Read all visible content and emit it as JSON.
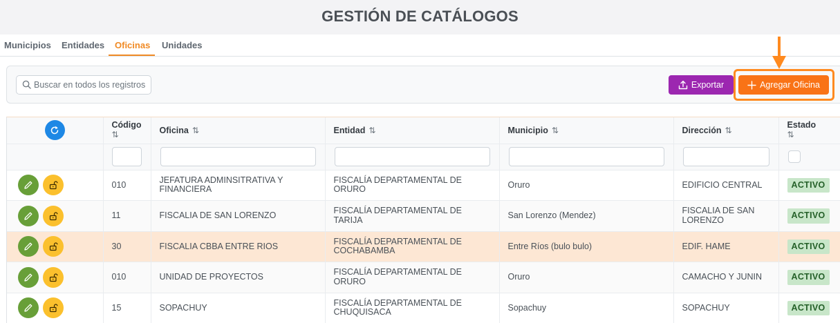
{
  "header": {
    "title": "GESTIÓN DE CATÁLOGOS"
  },
  "tabs": [
    {
      "label": "Municipios",
      "active": false
    },
    {
      "label": "Entidades",
      "active": false
    },
    {
      "label": "Oficinas",
      "active": true
    },
    {
      "label": "Unidades",
      "active": false
    }
  ],
  "toolbar": {
    "search_placeholder": "Buscar en todos los registros",
    "export_label": "Exportar",
    "add_label": "Agregar Oficina"
  },
  "table": {
    "columns": {
      "codigo": "Código",
      "oficina": "Oficina",
      "entidad": "Entidad",
      "municipio": "Municipio",
      "direccion": "Dirección",
      "estado": "Estado"
    },
    "rows": [
      {
        "codigo": "010",
        "oficina": "JEFATURA ADMINSITRATIVA Y FINANCIERA",
        "entidad": "FISCALÍA DEPARTAMENTAL DE ORURO",
        "municipio": "Oruro",
        "direccion": "EDIFICIO CENTRAL",
        "estado": "ACTIVO"
      },
      {
        "codigo": "11",
        "oficina": "FISCALIA DE SAN LORENZO",
        "entidad": "FISCALÍA DEPARTAMENTAL DE TARIJA",
        "municipio": "San Lorenzo (Mendez)",
        "direccion": "FISCALIA DE SAN LORENZO",
        "estado": "ACTIVO"
      },
      {
        "codigo": "30",
        "oficina": "FISCALIA CBBA ENTRE RIOS",
        "entidad": "FISCALÍA DEPARTAMENTAL DE COCHABAMBA",
        "municipio": "Entre Ríos (bulo bulo)",
        "direccion": "EDIF. HAME",
        "estado": "ACTIVO"
      },
      {
        "codigo": "010",
        "oficina": "UNIDAD DE PROYECTOS",
        "entidad": "FISCALÍA DEPARTAMENTAL DE ORURO",
        "municipio": "Oruro",
        "direccion": "CAMACHO Y JUNIN",
        "estado": "ACTIVO"
      },
      {
        "codigo": "15",
        "oficina": "SOPACHUY",
        "entidad": "FISCALÍA DEPARTAMENTAL DE CHUQUISACA",
        "municipio": "Sopachuy",
        "direccion": "SOPACHUY",
        "estado": "ACTIVO"
      }
    ]
  },
  "colors": {
    "accent": "#f08a24",
    "export": "#9c27b0",
    "add": "#f97316",
    "edit": "#689f38",
    "unlock": "#fbc02d",
    "refresh": "#1e88e5",
    "active_badge_bg": "#c8e6c9",
    "active_badge_text": "#256029",
    "highlight_row": "#fde7d4"
  },
  "icons": {
    "search": "search-icon",
    "export": "upload-icon",
    "add": "plus-icon",
    "refresh": "refresh-icon",
    "edit": "pencil-icon",
    "unlock": "unlock-icon",
    "sort": "sort-icon",
    "annotation": "arrow-down-icon"
  }
}
